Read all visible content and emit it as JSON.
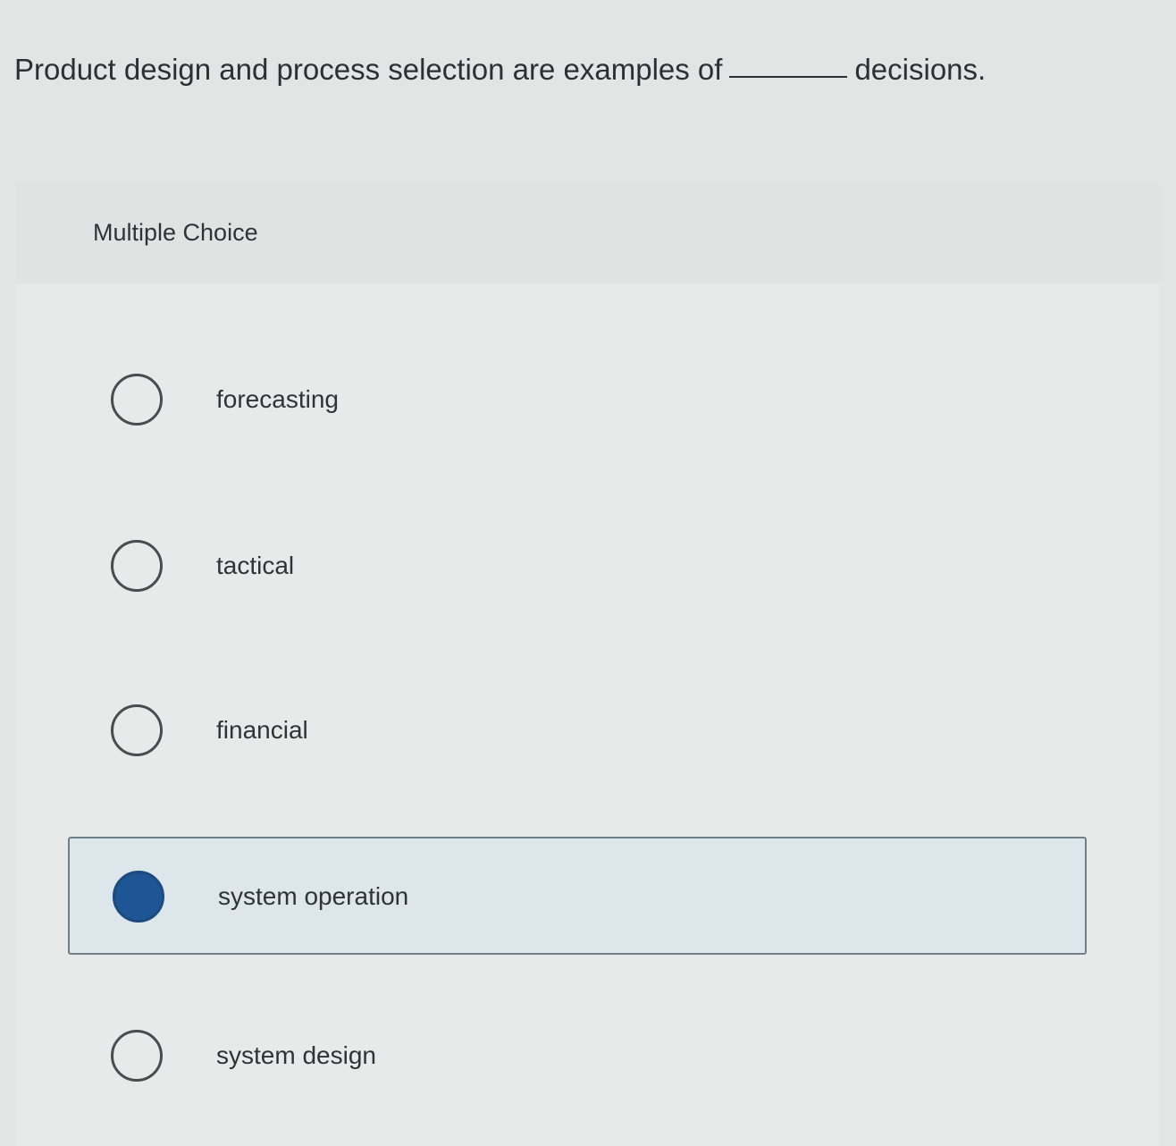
{
  "question": {
    "text_before": "Product design and process selection are examples of",
    "text_after": "decisions."
  },
  "quiz": {
    "type_label": "Multiple Choice",
    "options": [
      {
        "label": "forecasting",
        "selected": false
      },
      {
        "label": "tactical",
        "selected": false
      },
      {
        "label": "financial",
        "selected": false
      },
      {
        "label": "system operation",
        "selected": true
      },
      {
        "label": "system design",
        "selected": false
      }
    ]
  },
  "colors": {
    "selected_radio": "#1e5594",
    "selected_background": "#dde6ea",
    "text": "#2f3336"
  }
}
